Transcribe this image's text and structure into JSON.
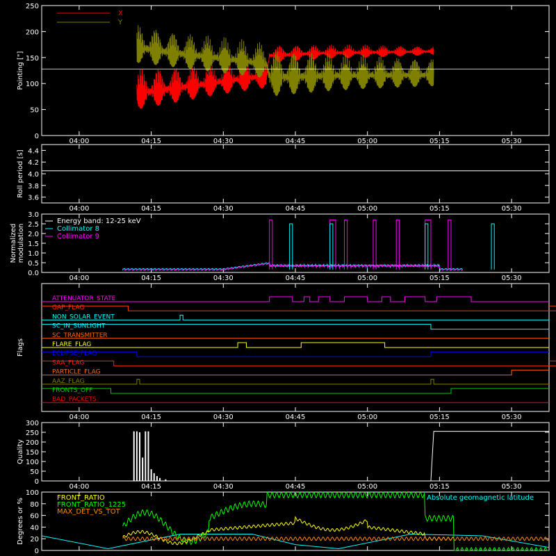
{
  "time_ticks": [
    "04:00",
    "04:15",
    "04:30",
    "04:45",
    "05:00",
    "05:15",
    "05:30"
  ],
  "chart_data": [
    {
      "type": "line",
      "ylabel": "Pointing [\"]",
      "ylim": [
        0,
        250
      ],
      "yticks": [
        "0",
        "50",
        "100",
        "150",
        "200",
        "250"
      ],
      "series": [
        {
          "name": "X",
          "color": "#ff0000",
          "envelope": [
            {
              "t": 4.2,
              "lo": 50,
              "hi": 130
            },
            {
              "t": 4.35,
              "lo": 65,
              "hi": 135
            },
            {
              "t": 4.5,
              "lo": 80,
              "hi": 140
            },
            {
              "t": 4.65,
              "lo": 92,
              "hi": 150
            },
            {
              "t": 4.66,
              "lo": 140,
              "hi": 175
            },
            {
              "t": 4.85,
              "lo": 148,
              "hi": 175
            },
            {
              "t": 5.0,
              "lo": 150,
              "hi": 175
            },
            {
              "t": 5.23,
              "lo": 155,
              "hi": 172
            }
          ]
        },
        {
          "name": "Y",
          "color": "#808000",
          "envelope": [
            {
              "t": 4.2,
              "lo": 140,
              "hi": 215
            },
            {
              "t": 4.35,
              "lo": 130,
              "hi": 200
            },
            {
              "t": 4.5,
              "lo": 120,
              "hi": 190
            },
            {
              "t": 4.65,
              "lo": 110,
              "hi": 180
            },
            {
              "t": 4.66,
              "lo": 75,
              "hi": 170
            },
            {
              "t": 4.85,
              "lo": 85,
              "hi": 160
            },
            {
              "t": 5.0,
              "lo": 90,
              "hi": 155
            },
            {
              "t": 5.23,
              "lo": 95,
              "hi": 150
            }
          ]
        }
      ],
      "reference_line": 128
    },
    {
      "type": "line",
      "ylabel": "Roll period [s]",
      "ylim": [
        3.5,
        4.5
      ],
      "yticks": [
        "3.6",
        "3.8",
        "4.0",
        "4.2",
        "4.4"
      ],
      "series": [
        {
          "color": "#ffffff",
          "constant": 4.05
        }
      ]
    },
    {
      "type": "line",
      "ylabel": [
        "Normalized",
        "modulation"
      ],
      "ylim": [
        0,
        3.0
      ],
      "yticks": [
        "0.0",
        "0.5",
        "1.0",
        "1.5",
        "2.0",
        "2.5",
        "3.0"
      ],
      "legend": [
        "Energy band: 12-25 keV",
        "Collimator 8",
        "Collimator 9"
      ],
      "legend_colors": [
        "#ffffff",
        "#00ffff",
        "#ff00ff"
      ],
      "spikes_c9": [
        [
          4.66,
          4.67
        ],
        [
          4.87,
          4.89
        ],
        [
          4.92,
          4.93
        ],
        [
          5.02,
          5.03
        ],
        [
          5.1,
          5.11
        ],
        [
          5.2,
          5.22
        ],
        [
          5.28,
          5.29
        ]
      ],
      "spikes_c8": [
        [
          4.73,
          4.74
        ],
        [
          4.87,
          4.88
        ],
        [
          5.2,
          5.21
        ],
        [
          5.43,
          5.44
        ]
      ]
    },
    {
      "type": "flags",
      "ylabel": "Flags",
      "flags": [
        {
          "label": "ATTENUATOR_STATE",
          "color": "#ff00ff",
          "on": [
            [
              4.66,
              4.74
            ],
            [
              4.78,
              4.8
            ],
            [
              4.83,
              4.87
            ],
            [
              4.92,
              5.0
            ],
            [
              5.05,
              5.08
            ],
            [
              5.13,
              5.2
            ],
            [
              5.24,
              5.36
            ]
          ],
          "all": false
        },
        {
          "label": "GAP_FLAG",
          "color": "#ff3300",
          "on": [
            [
              3.87,
              4.17
            ],
            [
              5.75,
              5.98
            ]
          ]
        },
        {
          "label": "NON_SOLAR_EVENT",
          "color": "#00ffff",
          "on": [
            [
              4.35,
              4.36
            ]
          ]
        },
        {
          "label": "SC_IN_SUNLIGHT",
          "color": "#00ffff",
          "on": [
            [
              3.87,
              5.22
            ]
          ]
        },
        {
          "label": "SC_TRANSMITTER",
          "color": "#ff6600",
          "on": []
        },
        {
          "label": "FLARE_FLAG",
          "color": "#ffff00",
          "on": [
            [
              4.55,
              4.58
            ],
            [
              4.77,
              5.06
            ]
          ]
        },
        {
          "label": "ECLIPSE_FLAG",
          "color": "#0000ff",
          "on": [
            [
              3.87,
              4.2
            ],
            [
              5.22,
              5.98
            ]
          ]
        },
        {
          "label": "SAA_FLAG",
          "color": "#ff2200",
          "on": [
            [
              3.87,
              4.12
            ],
            [
              5.8,
              5.98
            ]
          ]
        },
        {
          "label": "PARTICLE_FLAG",
          "color": "#ff6600",
          "on": [
            [
              5.5,
              5.98
            ]
          ]
        },
        {
          "label": "AAZ_FLAG",
          "color": "#808000",
          "on": [
            [
              4.2,
              4.21
            ],
            [
              5.22,
              5.23
            ]
          ]
        },
        {
          "label": "FRONTS_OFF",
          "color": "#00cc00",
          "on": [
            [
              3.87,
              4.11
            ],
            [
              5.29,
              5.98
            ]
          ]
        },
        {
          "label": "BAD_PACKETS",
          "color": "#ff0000",
          "on": []
        }
      ]
    },
    {
      "type": "line",
      "ylabel": "Quality",
      "ylim": [
        0,
        300
      ],
      "yticks": [
        "0",
        "50",
        "100",
        "150",
        "200",
        "250",
        "300"
      ]
    },
    {
      "type": "line",
      "ylabel": "Degrees or %",
      "ylim": [
        0,
        100
      ],
      "yticks": [
        "0",
        "20",
        "40",
        "60",
        "80",
        "100"
      ],
      "legend_left": [
        "FRONT_RATIO",
        "FRONT_RATIO_1225",
        "MAX_DET_VS_TOT"
      ],
      "legend_left_colors": [
        "#ffff00",
        "#00ff00",
        "#ff8800"
      ],
      "legend_right": "Absolute geomagnetic latitude",
      "legend_right_color": "#00ffff"
    }
  ]
}
